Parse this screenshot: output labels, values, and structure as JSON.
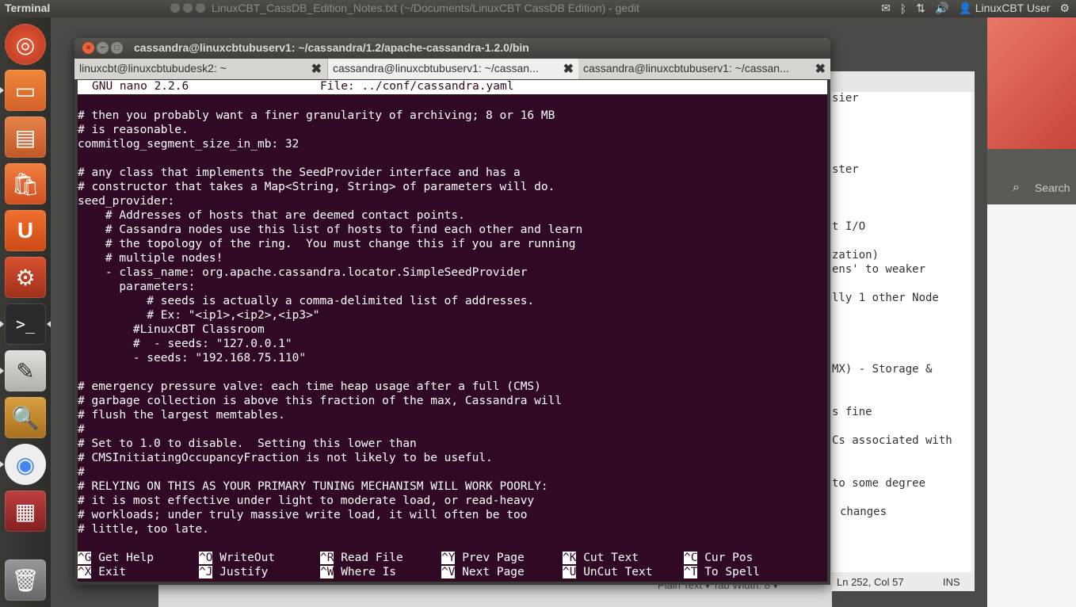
{
  "top_panel": {
    "app_title": "Terminal",
    "background_window_title": "LinuxCBT_CassDB_Edition_Notes.txt (~/Documents/LinuxCBT CassDB Edition) - gedit",
    "background_window_short": "Linu",
    "user": "LinuxCBT User"
  },
  "terminal": {
    "title": "cassandra@linuxcbtubuserv1: ~/cassandra/1.2/apache-cassandra-1.2.0/bin",
    "tabs": [
      {
        "label": "linuxcbt@linuxcbtubudesk2: ~"
      },
      {
        "label": "cassandra@linuxcbtubuserv1: ~/cassan..."
      },
      {
        "label": "cassandra@linuxcbtubuserv1: ~/cassan..."
      }
    ],
    "tab_close": "✖"
  },
  "nano": {
    "version": "GNU nano 2.2.6",
    "file": "File: ../conf/cassandra.yaml",
    "lines": [
      "# then you probably want a finer granularity of archiving; 8 or 16 MB",
      "# is reasonable.",
      "commitlog_segment_size_in_mb: 32",
      "",
      "# any class that implements the SeedProvider interface and has a",
      "# constructor that takes a Map<String, String> of parameters will do.",
      "seed_provider:",
      "    # Addresses of hosts that are deemed contact points.",
      "    # Cassandra nodes use this list of hosts to find each other and learn",
      "    # the topology of the ring.  You must change this if you are running",
      "    # multiple nodes!",
      "    - class_name: org.apache.cassandra.locator.SimpleSeedProvider",
      "      parameters:",
      "          # seeds is actually a comma-delimited list of addresses.",
      "          # Ex: \"<ip1>,<ip2>,<ip3>\"",
      "        #LinuxCBT Classroom",
      "        #  - seeds: \"127.0.0.1\"",
      "        - seeds: \"192.168.75.110\"",
      "",
      "# emergency pressure valve: each time heap usage after a full (CMS)",
      "# garbage collection is above this fraction of the max, Cassandra will",
      "# flush the largest memtables.",
      "#",
      "# Set to 1.0 to disable.  Setting this lower than",
      "# CMSInitiatingOccupancyFraction is not likely to be useful.",
      "#",
      "# RELYING ON THIS AS YOUR PRIMARY TUNING MECHANISM WILL WORK POORLY:",
      "# it is most effective under light to moderate load, or read-heavy",
      "# workloads; under truly massive write load, it will often be too",
      "# little, too late."
    ],
    "shortcuts_row1": [
      {
        "key": "^G",
        "label": "Get Help"
      },
      {
        "key": "^O",
        "label": "WriteOut"
      },
      {
        "key": "^R",
        "label": "Read File"
      },
      {
        "key": "^Y",
        "label": "Prev Page"
      },
      {
        "key": "^K",
        "label": "Cut Text"
      },
      {
        "key": "^C",
        "label": "Cur Pos"
      }
    ],
    "shortcuts_row2": [
      {
        "key": "^X",
        "label": "Exit"
      },
      {
        "key": "^J",
        "label": "Justify"
      },
      {
        "key": "^W",
        "label": "Where Is"
      },
      {
        "key": "^V",
        "label": "Next Page"
      },
      {
        "key": "^U",
        "label": "UnCut Text"
      },
      {
        "key": "^T",
        "label": "To Spell"
      }
    ]
  },
  "gedit": {
    "lines": [
      "sier",
      "ster",
      "t I/O",
      "zation)",
      "ens' to weaker",
      "lly 1 other Node",
      "MX) - Storage &",
      "s fine",
      "Cs associated with",
      "to some degree",
      "changes"
    ],
    "status_position": "Ln 252, Col 57",
    "status_mode": "INS",
    "status_left": "Plain Text ▾   Tab Width: 8 ▾"
  },
  "search": {
    "label": "Search"
  },
  "colors": {
    "terminal_bg": "#300a24",
    "terminal_fg": "#ffffff",
    "panel_bg": "#3c3b37",
    "close_button": "#e8633a"
  }
}
